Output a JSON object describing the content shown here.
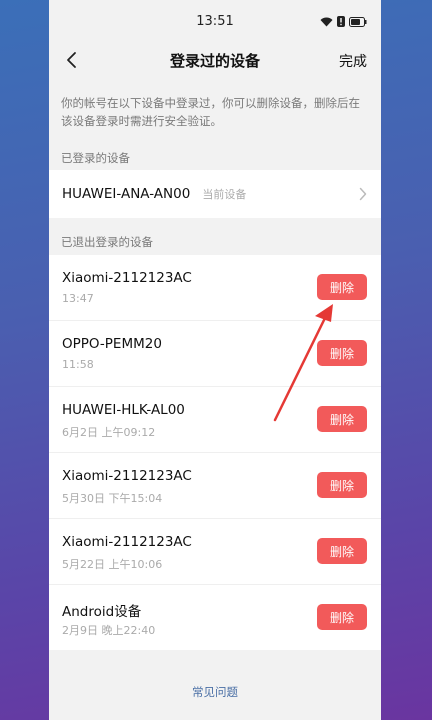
{
  "status_bar": {
    "time": "13:51",
    "icons": [
      "wifi-icon",
      "alert-icon",
      "battery-icon"
    ]
  },
  "nav": {
    "title": "登录过的设备",
    "done_label": "完成",
    "back_icon": "chevron-left-icon"
  },
  "description": "你的帐号在以下设备中登录过，你可以删除设备，删除后在该设备登录时需进行安全验证。",
  "logged_in": {
    "section_label": "已登录的设备",
    "device_name": "HUAWEI-ANA-AN00",
    "tag": "当前设备"
  },
  "logged_out": {
    "section_label": "已退出登录的设备",
    "devices": [
      {
        "name": "Xiaomi-2112123AC",
        "time": "13:47",
        "delete_label": "删除"
      },
      {
        "name": "OPPO-PEMM20",
        "time": "11:58",
        "delete_label": "删除"
      },
      {
        "name": "HUAWEI-HLK-AL00",
        "time": "6月2日 上午09:12",
        "delete_label": "删除"
      },
      {
        "name": "Xiaomi-2112123AC",
        "time": "5月30日 下午15:04",
        "delete_label": "删除"
      },
      {
        "name": "Xiaomi-2112123AC",
        "time": "5月22日 上午10:06",
        "delete_label": "删除"
      },
      {
        "name": "Android设备",
        "time": "2月9日 晚上22:40",
        "delete_label": "删除"
      }
    ]
  },
  "faq_label": "常见问题",
  "colors": {
    "delete_button": "#f25a5a",
    "annotation_arrow": "#e53935",
    "background_gradient_start": "#3b6fb8",
    "background_gradient_end": "#6a35a0"
  }
}
